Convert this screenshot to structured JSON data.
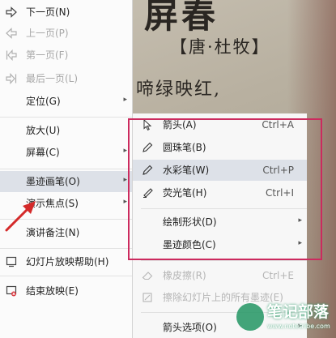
{
  "slide": {
    "title": "屏春",
    "author": "【唐·杜牧】",
    "line": "啼绿映红,"
  },
  "main_menu": {
    "items": [
      {
        "label": "下一页(N)",
        "icon": "arrow-right-icon",
        "disabled": false
      },
      {
        "label": "上一页(P)",
        "icon": "arrow-left-icon",
        "disabled": true
      },
      {
        "label": "第一页(F)",
        "icon": "first-page-icon",
        "disabled": true
      },
      {
        "label": "最后一页(L)",
        "icon": "last-page-icon",
        "disabled": true
      },
      {
        "label": "定位(G)",
        "submenu": true
      },
      {
        "label": "放大(U)"
      },
      {
        "label": "屏幕(C)",
        "submenu": true
      },
      {
        "label": "墨迹画笔(O)",
        "submenu": true,
        "highlighted": true
      },
      {
        "label": "演示焦点(S)",
        "submenu": true
      },
      {
        "label": "演讲备注(N)"
      },
      {
        "label": "幻灯片放映帮助(H)",
        "icon": "help-icon"
      },
      {
        "label": "结束放映(E)",
        "icon": "end-show-icon"
      }
    ]
  },
  "sub_menu": {
    "items": [
      {
        "label": "箭头(A)",
        "shortcut": "Ctrl+A",
        "icon": "arrow-cursor-icon"
      },
      {
        "label": "圆珠笔(B)",
        "icon": "ballpoint-pen-icon"
      },
      {
        "label": "水彩笔(W)",
        "shortcut": "Ctrl+P",
        "icon": "watercolor-pen-icon",
        "highlighted": true
      },
      {
        "label": "荧光笔(H)",
        "shortcut": "Ctrl+I",
        "icon": "highlighter-icon"
      },
      {
        "label": "绘制形状(D)",
        "submenu": true
      },
      {
        "label": "墨迹颜色(C)",
        "submenu": true
      },
      {
        "label": "橡皮擦(R)",
        "shortcut": "Ctrl+E",
        "icon": "eraser-icon",
        "disabled": true
      },
      {
        "label": "擦除幻灯片上的所有墨迹(E)",
        "icon": "erase-all-icon",
        "disabled": true
      },
      {
        "label": "箭头选项(O)",
        "submenu": true
      }
    ]
  },
  "watermark": {
    "text": "笔记部落",
    "url": "www.notetribe.com"
  },
  "colors": {
    "highlight_box": "#cc2a5e",
    "pointer_arrow": "#d42a2a",
    "menu_highlight": "#dde1e8"
  }
}
